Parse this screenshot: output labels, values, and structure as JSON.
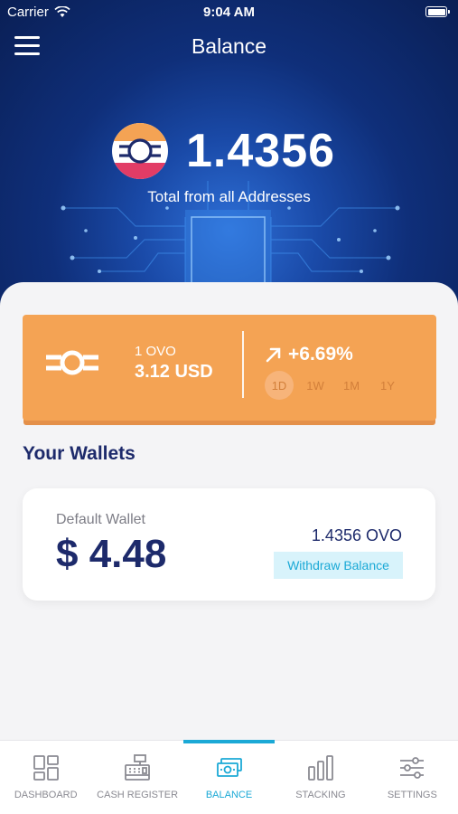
{
  "status_bar": {
    "carrier": "Carrier",
    "time": "9:04 AM"
  },
  "header": {
    "title": "Balance"
  },
  "balance": {
    "amount": "1.4356",
    "caption": "Total from all Addresses"
  },
  "price_card": {
    "pair_label": "1 OVO",
    "usd_value": "3.12 USD",
    "change": "+6.69%",
    "periods": [
      "1D",
      "1W",
      "1M",
      "1Y"
    ],
    "active_period": "1D"
  },
  "wallets": {
    "title": "Your Wallets",
    "items": [
      {
        "name": "Default Wallet",
        "usd": "$ 4.48",
        "ovo": "1.4356 OVO",
        "action": "Withdraw Balance"
      }
    ]
  },
  "tabbar": {
    "items": [
      {
        "label": "DASHBOARD",
        "icon": "dashboard-icon"
      },
      {
        "label": "CASH REGISTER",
        "icon": "cash-register-icon"
      },
      {
        "label": "BALANCE",
        "icon": "balance-icon"
      },
      {
        "label": "STACKING",
        "icon": "stacking-icon"
      },
      {
        "label": "SETTINGS",
        "icon": "settings-icon"
      }
    ],
    "active": "BALANCE"
  },
  "colors": {
    "hero": "#0f2f7a",
    "accent_orange": "#f4a354",
    "navy": "#1d2a6b",
    "active_blue": "#1ba9d6"
  }
}
